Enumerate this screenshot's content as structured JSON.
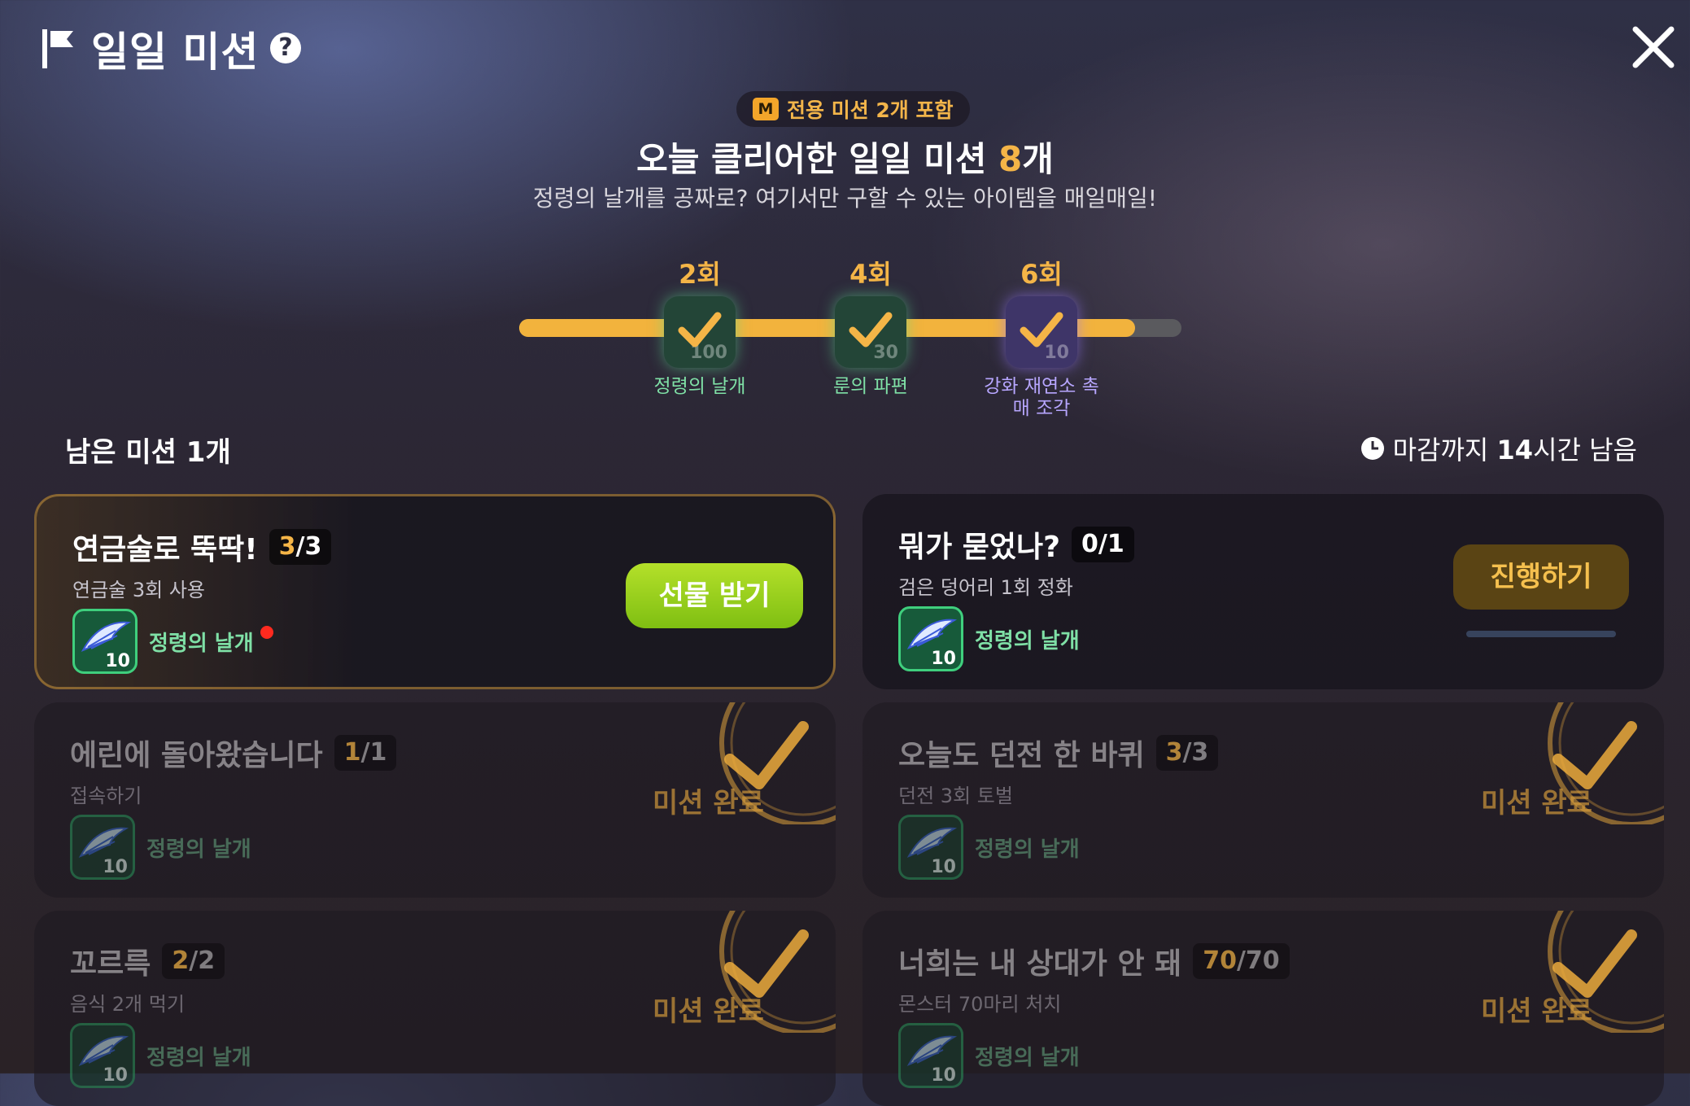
{
  "header": {
    "title": "일일 미션",
    "help_icon": "?",
    "close_icon": "close-icon"
  },
  "summary": {
    "exclusive_badge": "M",
    "exclusive_text": "전용 미션 2개 포함",
    "cleared_prefix": "오늘 클리어한 일일 미션 ",
    "cleared_count": "8",
    "cleared_suffix": "개",
    "subtitle": "정령의 날개를 공짜로? 여기서만 구할 수 있는 아이템을 매일매일!"
  },
  "progress": {
    "fill_fraction": 0.93,
    "milestones": [
      {
        "count": "2회",
        "qty": "100",
        "label": "정령의 날개",
        "color": "green"
      },
      {
        "count": "4회",
        "qty": "30",
        "label": "룬의 파편",
        "color": "green"
      },
      {
        "count": "6회",
        "qty": "10",
        "label": "강화 재연소 촉매 조각",
        "color": "purple"
      }
    ]
  },
  "remaining": "남은 미션 1개",
  "deadline": {
    "prefix": "마감까지 ",
    "hours": "14",
    "suffix": "시간 남음"
  },
  "missions": [
    {
      "name": "연금술로 뚝딱!",
      "current": "3",
      "total": "/3",
      "desc": "연금술 3회 사용",
      "reward_qty": "10",
      "reward_name": "정령의 날개",
      "action": "선물 받기",
      "state": "claimable"
    },
    {
      "name": "뭐가 묻었나?",
      "current": "0",
      "total": "/1",
      "desc": "검은 덩어리 1회 정화",
      "reward_qty": "10",
      "reward_name": "정령의 날개",
      "action": "진행하기",
      "state": "in-progress"
    },
    {
      "name": "에린에 돌아왔습니다",
      "current": "1",
      "total": "/1",
      "desc": "접속하기",
      "reward_qty": "10",
      "reward_name": "정령의 날개",
      "action": "미션 완료",
      "state": "done"
    },
    {
      "name": "오늘도 던전 한 바퀴",
      "current": "3",
      "total": "/3",
      "desc": "던전 3회 토벌",
      "reward_qty": "10",
      "reward_name": "정령의 날개",
      "action": "미션 완료",
      "state": "done"
    },
    {
      "name": "꼬르륵",
      "current": "2",
      "total": "/2",
      "desc": "음식 2개 먹기",
      "reward_qty": "10",
      "reward_name": "정령의 날개",
      "action": "미션 완료",
      "state": "done"
    },
    {
      "name": "너희는 내 상대가 안 돼",
      "current": "70",
      "total": "/70",
      "desc": "몬스터 70마리 처치",
      "reward_qty": "10",
      "reward_name": "정령의 날개",
      "action": "미션 완료",
      "state": "done"
    }
  ]
}
